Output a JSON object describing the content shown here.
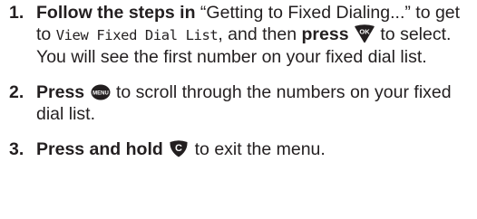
{
  "steps": [
    {
      "number": "1.",
      "part1_bold": "Follow the steps in",
      "part2": " “Getting to Fixed Dialing...” to get to ",
      "menu_item": "View Fixed Dial List",
      "part3": ", and then ",
      "part4_bold": "press",
      "icon": "ok-key-icon",
      "icon_label": "OK",
      "part5": " to select. You will see the first number on your fixed dial list."
    },
    {
      "number": "2.",
      "part1_bold": "Press",
      "icon": "menu-key-icon",
      "icon_label": "MENU",
      "part2": " to scroll through the numbers on your fixed dial list."
    },
    {
      "number": "3.",
      "part1_bold": "Press and hold",
      "icon": "c-key-icon",
      "icon_label": "C",
      "part2": " to exit the menu."
    }
  ],
  "colors": {
    "text": "#231f20",
    "key": "#231f20",
    "key_label": "#ffffff"
  }
}
